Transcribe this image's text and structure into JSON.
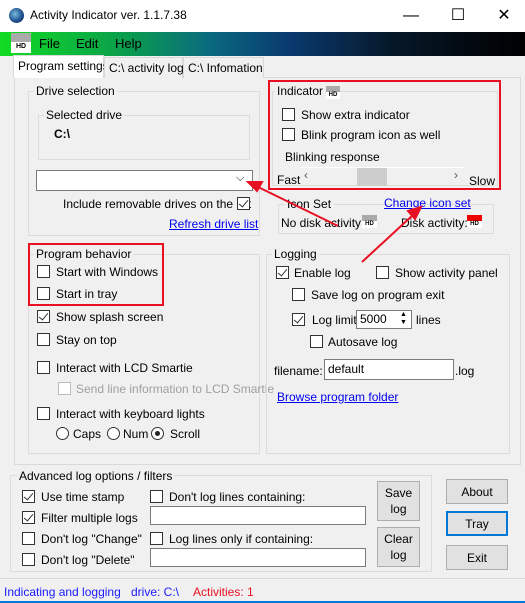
{
  "window": {
    "title": "Activity Indicator ver. 1.1.7.38",
    "minimize": "—",
    "maximize": "☐",
    "close": "✕"
  },
  "menu": {
    "icon_text": "HD",
    "items": [
      "File",
      "Edit",
      "Help"
    ]
  },
  "tabs": [
    "Program settings",
    "C:\\ activity log",
    "C:\\ Infomation"
  ],
  "drive": {
    "group": "Drive selection",
    "selected_label": "Selected drive",
    "selected_value": "C:\\",
    "combo_value": "",
    "include_removable": "Include removable drives on the list",
    "include_removable_checked": true,
    "refresh": "Refresh drive list"
  },
  "indicator": {
    "group": "Indicator",
    "show_extra": "Show extra indicator",
    "show_extra_checked": false,
    "blink": "Blink program icon as well",
    "blink_checked": false,
    "blinking_response": "Blinking response",
    "fast": "Fast",
    "slow": "Slow",
    "slider_position_percent": 40
  },
  "iconset": {
    "group": "Icon Set",
    "change": "Change icon set",
    "no_disk": "No disk activity:",
    "disk": "Disk activity:",
    "icon_text": "HD"
  },
  "behavior": {
    "group": "Program behavior",
    "start_windows": "Start with Windows",
    "start_tray": "Start in tray",
    "splash": "Show splash screen",
    "stay_top": "Stay on top",
    "lcd": "Interact with LCD Smartie",
    "lcd_send": "Send line information to LCD Smartie",
    "keyboard": "Interact with keyboard lights",
    "radios": [
      "Caps",
      "Num",
      "Scroll"
    ],
    "radio_selected": "Scroll"
  },
  "logging": {
    "group": "Logging",
    "enable": "Enable log",
    "show_panel": "Show activity panel",
    "save_exit": "Save log on program exit",
    "log_limit": "Log limit:",
    "limit_value": "5000",
    "lines": "lines",
    "autosave": "Autosave log",
    "filename_label": "filename:",
    "filename_value": "default",
    "ext": ".log",
    "browse": "Browse program folder"
  },
  "advanced": {
    "group": "Advanced log options / filters",
    "time_stamp": "Use time stamp",
    "filter_multiple": "Filter multiple logs",
    "no_change": "Don't log \"Change\"",
    "no_delete": "Don't log \"Delete\"",
    "dont_containing": "Don't log lines containing:",
    "only_containing": "Log lines only if containing:",
    "dont_value": "",
    "only_value": "",
    "save_log": "Save log",
    "clear_log": "Clear log"
  },
  "buttons": {
    "about": "About",
    "tray": "Tray",
    "exit": "Exit"
  },
  "status": {
    "mode": "Indicating and logging",
    "drive": "drive: C:\\",
    "activities": "Activities: 1"
  },
  "colors": {
    "highlight": "#e81123",
    "link": "#0000ee",
    "status_blue": "#1a1aff",
    "status_red": "#e81123"
  }
}
